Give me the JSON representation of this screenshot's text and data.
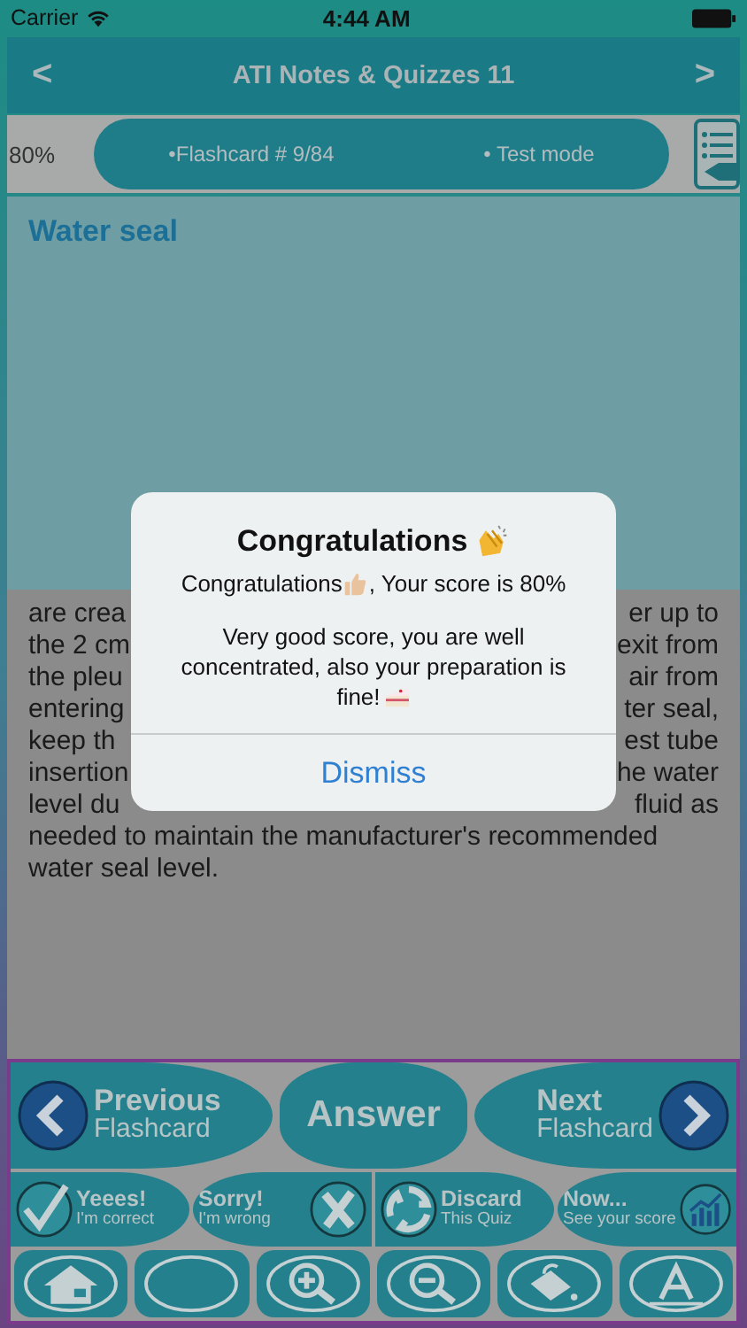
{
  "status_bar": {
    "carrier": "Carrier",
    "time": "4:44 AM"
  },
  "nav_bar": {
    "back": "<",
    "title": "ATI Notes & Quizzes 11",
    "forward": ">"
  },
  "info_bar": {
    "score": "80%",
    "flashcard": "•Flashcard #  9/84",
    "mode": "• Test mode"
  },
  "card": {
    "heading": "Water seal",
    "split_lines": [
      {
        "left": "are crea",
        "right": "er up to"
      },
      {
        "left": "the 2 cm",
        "right": "exit from"
      },
      {
        "left": "the pleu",
        "right": "air from"
      },
      {
        "left": "entering",
        "right": "ter seal,"
      },
      {
        "left": "keep th",
        "right": "est tube"
      },
      {
        "left": "insertion",
        "right": "he water"
      },
      {
        "left": "level du",
        "right": "fluid as"
      }
    ],
    "full_lines": [
      "needed to maintain the manufacturer's recommended",
      "water seal level."
    ]
  },
  "nav_buttons": [
    {
      "kind": "previous",
      "title": "Previous",
      "subtitle": "Flashcard"
    },
    {
      "kind": "answer",
      "title": "Answer"
    },
    {
      "kind": "next",
      "title": "Next",
      "subtitle": "Flashcard"
    }
  ],
  "mark_buttons": [
    {
      "kind": "correct",
      "title": "Yeees!",
      "subtitle": "I'm correct"
    },
    {
      "kind": "wrong",
      "title": "Sorry!",
      "subtitle": "I'm wrong"
    },
    {
      "kind": "discard",
      "title": "Discard",
      "subtitle": "This Quiz"
    },
    {
      "kind": "score",
      "title": "Now...",
      "subtitle": "See your score"
    }
  ],
  "toolbar": [
    {
      "kind": "home"
    },
    {
      "kind": "blank"
    },
    {
      "kind": "zoom-in"
    },
    {
      "kind": "zoom-out"
    },
    {
      "kind": "paint"
    },
    {
      "kind": "font"
    }
  ],
  "alert": {
    "title": "Congratulations",
    "message_start": "Congratulations",
    "message_end": ", Your score is 80%",
    "message_2": "Very good score, you are well concentrated, also your preparation is",
    "message_2_end": "fine!",
    "action": "Dismiss"
  }
}
